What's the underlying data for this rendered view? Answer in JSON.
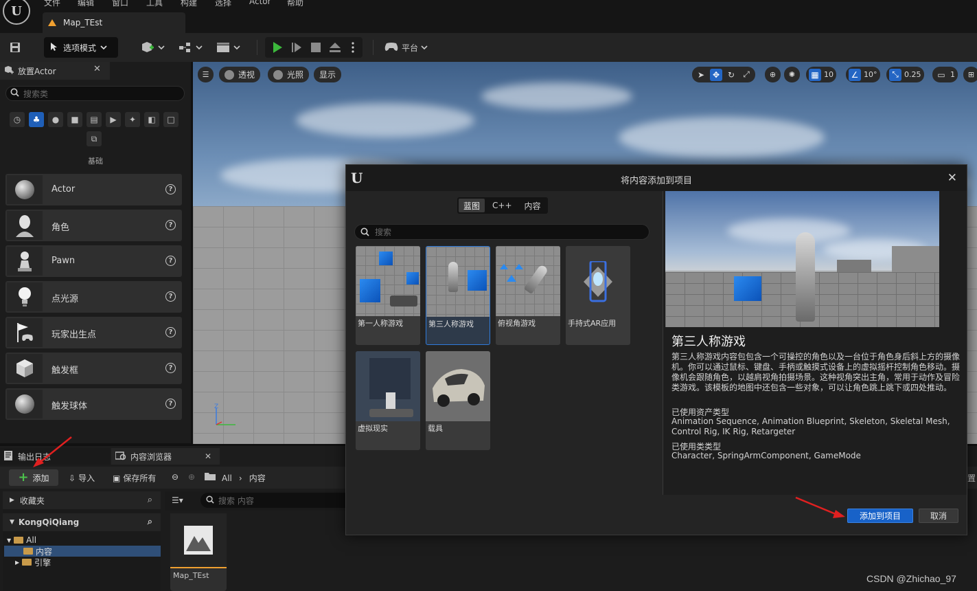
{
  "menu": [
    "文件",
    "编辑",
    "窗口",
    "工具",
    "构建",
    "选择",
    "Actor",
    "帮助"
  ],
  "doc_tab": "Map_TEst",
  "toolbar": {
    "mode_label": "选项模式",
    "platform_label": "平台"
  },
  "place_actor": {
    "title": "放置Actor",
    "search_placeholder": "搜索类",
    "category_label": "基础",
    "items": [
      {
        "label": "Actor"
      },
      {
        "label": "角色"
      },
      {
        "label": "Pawn"
      },
      {
        "label": "点光源"
      },
      {
        "label": "玩家出生点"
      },
      {
        "label": "触发框"
      },
      {
        "label": "触发球体"
      }
    ]
  },
  "viewport": {
    "perspective_label": "透视",
    "lighting_label": "光照",
    "show_label": "显示",
    "grid_snap": "10",
    "rotation_snap": "10°",
    "scale_snap": "0.25",
    "camera_speed": "1"
  },
  "bottom": {
    "output_log_tab": "输出日志",
    "content_browser_tab": "内容浏览器",
    "add_label": "添加",
    "import_label": "导入",
    "save_all_label": "保存所有",
    "breadcrumb": [
      "All",
      "内容"
    ],
    "favorites_label": "收藏夹",
    "project_label": "KongQiQiang",
    "tree": [
      "All",
      "内容",
      "引擎"
    ],
    "search_placeholder": "搜索 内容",
    "asset_name": "Map_TEst",
    "right_edge_text": "置"
  },
  "modal": {
    "title": "将内容添加到项目",
    "tabs": [
      "蓝图",
      "C++",
      "内容"
    ],
    "search_placeholder": "搜索",
    "templates": [
      {
        "name": "第一人称游戏"
      },
      {
        "name": "第三人称游戏"
      },
      {
        "name": "俯视角游戏"
      },
      {
        "name": "手持式AR应用"
      },
      {
        "name": "虚拟现实"
      },
      {
        "name": "载具"
      }
    ],
    "preview_title": "第三人称游戏",
    "preview_description": "第三人称游戏内容包包含一个可操控的角色以及一台位于角色身后斜上方的摄像机。你可以通过鼠标、键盘、手柄或触摸式设备上的虚拟摇杆控制角色移动。摄像机会跟随角色，以越肩视角拍摄场景。这种视角突出主角，常用于动作及冒险类游戏。该模板的地图中还包含一些对象，可以让角色跳上跳下或四处推动。",
    "asset_types_heading": "已使用资产类型",
    "asset_types": "Animation Sequence, Animation Blueprint, Skeleton, Skeletal Mesh, Control Rig, IK Rig, Retargeter",
    "class_types_heading": "已使用类类型",
    "class_types": "Character, SpringArmComponent, GameMode",
    "confirm_label": "添加到项目",
    "cancel_label": "取消"
  },
  "watermark": "CSDN @Zhichao_97",
  "colors": {
    "accent_blue": "#1862c8",
    "play_green": "#3cb83c",
    "annotation_red": "#e02020"
  }
}
